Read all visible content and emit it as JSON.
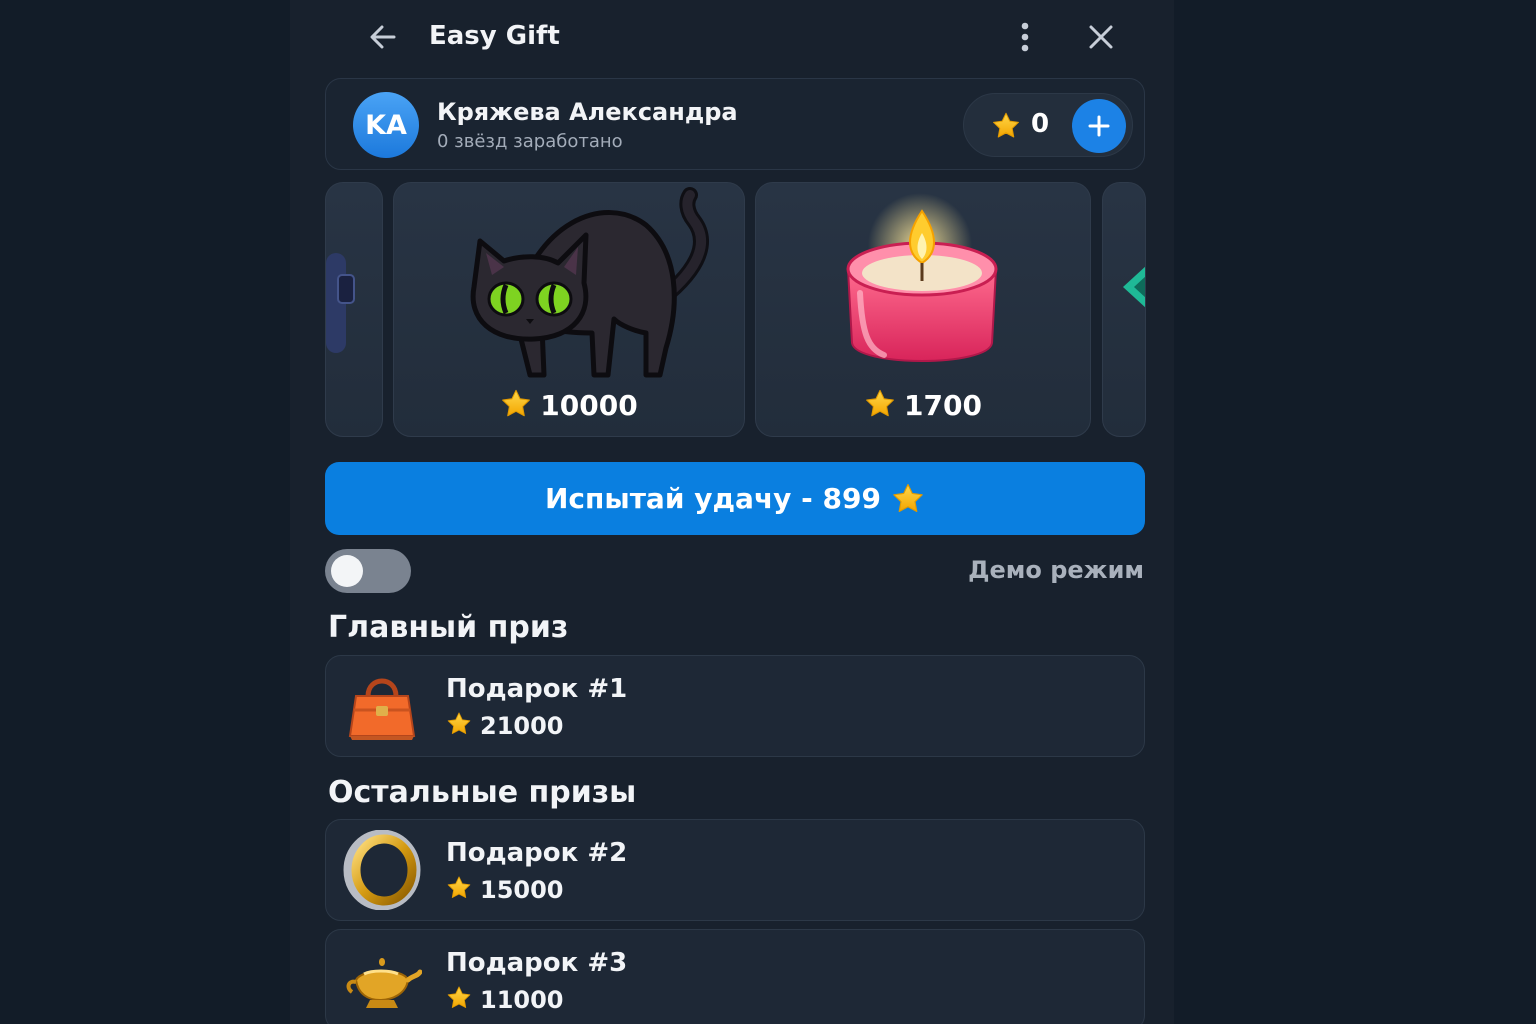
{
  "header": {
    "title": "Easy Gift",
    "icons": [
      "arrow-left-icon",
      "more-vertical-icon",
      "close-icon"
    ]
  },
  "profile": {
    "initials": "KA",
    "name": "Кряжева Александра",
    "subtitle": "0 звёзд заработано",
    "balance": "0"
  },
  "carousel": [
    {
      "icon": "black-cat-icon",
      "price": "10000"
    },
    {
      "icon": "candle-icon",
      "price": "1700"
    }
  ],
  "spin": {
    "label": "Испытай удачу - 899",
    "icon": "star-icon"
  },
  "demo": {
    "label": "Демо режим",
    "enabled": false
  },
  "main_prize": {
    "title": "Главный приз",
    "item": {
      "name": "Подарок #1",
      "value": "21000",
      "icon": "handbag-icon"
    }
  },
  "other_prizes": {
    "title": "Остальные призы",
    "items": [
      {
        "name": "Подарок #2",
        "value": "15000",
        "icon": "ring-icon"
      },
      {
        "name": "Подарок #3",
        "value": "11000",
        "icon": "magic-lamp-icon"
      }
    ]
  },
  "colors": {
    "accent": "#0a7fe0",
    "background": "#18212d",
    "star": "#f7b500"
  }
}
